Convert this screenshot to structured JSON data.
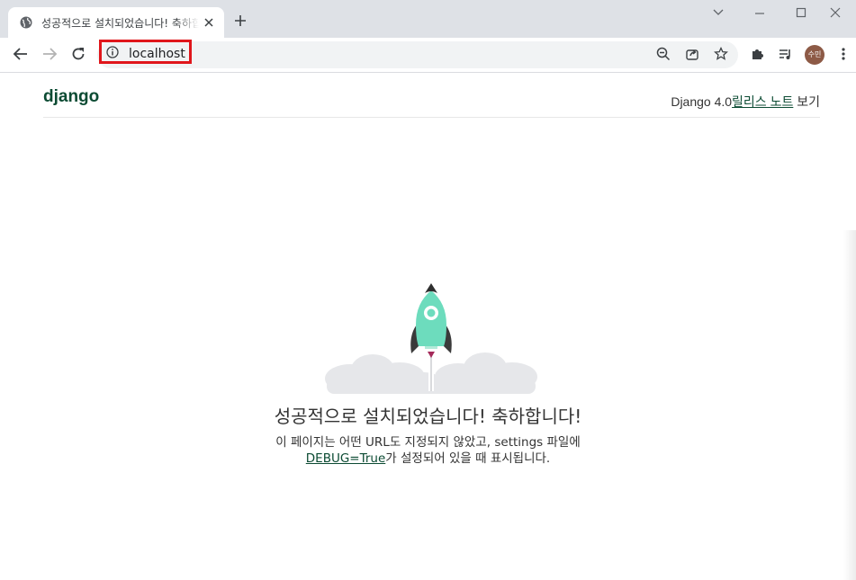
{
  "browser": {
    "tab": {
      "title": "성공적으로 설치되었습니다! 축하합니다!"
    },
    "address_bar": {
      "url": "localhost"
    },
    "profile": {
      "avatar_text": "수민"
    }
  },
  "django": {
    "logo": "django",
    "release": {
      "prefix": "Django 4.0",
      "link": "릴리스 노트",
      "suffix": " 보기"
    },
    "headline": "성공적으로 설치되었습니다! 축하합니다!",
    "body_line1": "이 페이지는 어떤 URL도 지정되지 않았고, settings 파일에",
    "body_link": "DEBUG=True",
    "body_line2": "가 설정되어 있을 때 표시됩니다."
  },
  "colors": {
    "accent": "#0c4b33",
    "rocket": "#6ddcbd",
    "highlight": "#e0161b"
  }
}
